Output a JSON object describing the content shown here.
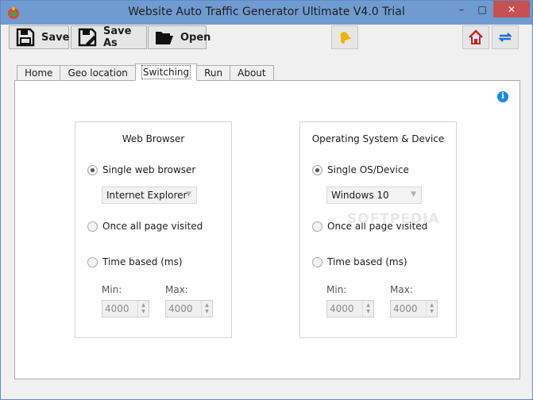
{
  "window": {
    "title": "Website Auto Traffic Generator Ultimate V4.0 Trial",
    "controls": {
      "minimize": "–",
      "maximize": "□",
      "close": "✕"
    }
  },
  "toolbar": {
    "save_label": "Save",
    "save_as_label": "Save As",
    "open_label": "Open",
    "icons": [
      "save-icon",
      "save-as-icon",
      "open-folder-icon",
      "bell-icon",
      "home-icon",
      "refresh-icon"
    ]
  },
  "tabs": [
    {
      "label": "Home",
      "active": false
    },
    {
      "label": "Geo location",
      "active": false
    },
    {
      "label": "Switching",
      "active": true
    },
    {
      "label": "Run",
      "active": false
    },
    {
      "label": "About",
      "active": false
    }
  ],
  "info_icon_glyph": "i",
  "web_browser": {
    "title": "Web Browser",
    "options": [
      "Single web browser",
      "Once all page visited",
      "Time based (ms)"
    ],
    "selected_option": "Single web browser",
    "browser_select": "Internet Explorer",
    "min_label": "Min:",
    "max_label": "Max:",
    "min_value": "4000",
    "max_value": "4000"
  },
  "operating_system": {
    "title": "Operating System & Device",
    "options": [
      "Single OS/Device",
      "Once all page visited",
      "Time based (ms)"
    ],
    "selected_option": "Single OS/Device",
    "os_select": "Windows 10",
    "min_label": "Min:",
    "max_label": "Max:",
    "min_value": "4000",
    "max_value": "4000"
  },
  "watermark": "SOFTPEDIA",
  "colors": {
    "titlebar": "#6f9bd1",
    "close_button": "#c75050",
    "info_icon": "#1e88e5",
    "bell": "#f0b400",
    "home": "#c62828",
    "refresh": "#1e6fd9"
  }
}
